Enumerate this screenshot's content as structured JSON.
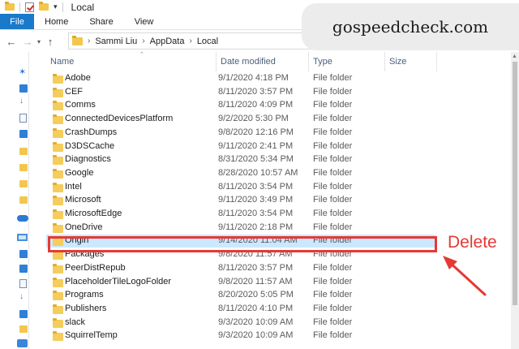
{
  "window": {
    "title": "Local"
  },
  "ribbon": {
    "tabs": [
      "File",
      "Home",
      "Share",
      "View"
    ]
  },
  "address": {
    "crumbs": [
      "Sammi Liu",
      "AppData",
      "Local"
    ]
  },
  "watermark": {
    "text": "gospeedcheck.com"
  },
  "columns": {
    "name": "Name",
    "date": "Date modified",
    "type": "Type",
    "size": "Size"
  },
  "files": [
    {
      "name": "Adobe",
      "date": "9/1/2020 4:18 PM",
      "type": "File folder"
    },
    {
      "name": "CEF",
      "date": "8/11/2020 3:57 PM",
      "type": "File folder"
    },
    {
      "name": "Comms",
      "date": "8/11/2020 4:09 PM",
      "type": "File folder"
    },
    {
      "name": "ConnectedDevicesPlatform",
      "date": "9/2/2020 5:30 PM",
      "type": "File folder"
    },
    {
      "name": "CrashDumps",
      "date": "9/8/2020 12:16 PM",
      "type": "File folder"
    },
    {
      "name": "D3DSCache",
      "date": "9/11/2020 2:41 PM",
      "type": "File folder"
    },
    {
      "name": "Diagnostics",
      "date": "8/31/2020 5:34 PM",
      "type": "File folder"
    },
    {
      "name": "Google",
      "date": "8/28/2020 10:57 AM",
      "type": "File folder"
    },
    {
      "name": "Intel",
      "date": "8/11/2020 3:54 PM",
      "type": "File folder"
    },
    {
      "name": "Microsoft",
      "date": "9/11/2020 3:49 PM",
      "type": "File folder"
    },
    {
      "name": "MicrosoftEdge",
      "date": "8/11/2020 3:54 PM",
      "type": "File folder"
    },
    {
      "name": "OneDrive",
      "date": "9/11/2020 2:18 PM",
      "type": "File folder"
    },
    {
      "name": "Origin",
      "date": "9/14/2020 11:04 AM",
      "type": "File folder",
      "selected": true
    },
    {
      "name": "Packages",
      "date": "9/8/2020 11:57 AM",
      "type": "File folder"
    },
    {
      "name": "PeerDistRepub",
      "date": "8/11/2020 3:57 PM",
      "type": "File folder"
    },
    {
      "name": "PlaceholderTileLogoFolder",
      "date": "9/8/2020 11:57 AM",
      "type": "File folder"
    },
    {
      "name": "Programs",
      "date": "8/20/2020 5:05 PM",
      "type": "File folder"
    },
    {
      "name": "Publishers",
      "date": "8/11/2020 4:10 PM",
      "type": "File folder"
    },
    {
      "name": "slack",
      "date": "9/3/2020 10:09 AM",
      "type": "File folder"
    },
    {
      "name": "SquirrelTemp",
      "date": "9/3/2020 10:09 AM",
      "type": "File folder"
    }
  ],
  "annotation": {
    "label": "Delete",
    "color": "#e53935"
  },
  "colors": {
    "file_tab": "#1979ca",
    "selected_row": "#cce8ff",
    "folder": "#f5cd5c"
  }
}
